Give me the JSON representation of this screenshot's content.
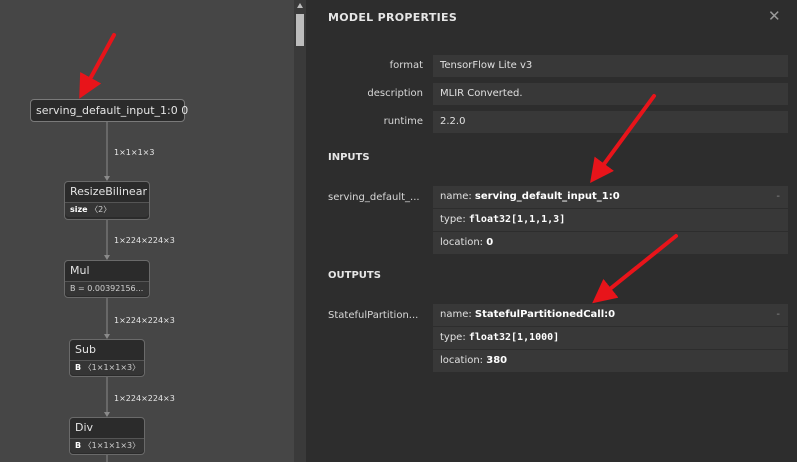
{
  "graph": {
    "input_node": "serving_default_input_1:0 0",
    "edges": [
      "1×1×1×3",
      "1×224×224×3",
      "1×224×224×3",
      "1×224×224×3"
    ],
    "nodes": [
      {
        "name": "ResizeBilinear",
        "attr_key": "size",
        "attr_val": "〈2〉"
      },
      {
        "name": "Mul",
        "attr_key": "",
        "attr_val": "B = 0.00392156..."
      },
      {
        "name": "Sub",
        "attr_key": "B",
        "attr_val": "〈1×1×1×3〉"
      },
      {
        "name": "Div",
        "attr_key": "B",
        "attr_val": "〈1×1×1×3〉"
      }
    ]
  },
  "panel": {
    "title": "MODEL PROPERTIES",
    "close": "✕",
    "properties": [
      {
        "label": "format",
        "value": "TensorFlow Lite v3"
      },
      {
        "label": "description",
        "value": "MLIR Converted."
      },
      {
        "label": "runtime",
        "value": "2.2.0"
      }
    ],
    "inputs": {
      "heading": "INPUTS",
      "label": "serving_default_...",
      "name_key": "name: ",
      "name": "serving_default_input_1:0",
      "type_key": "type: ",
      "type": "float32[1,1,1,3]",
      "location_key": "location: ",
      "location": "0",
      "dash": "-"
    },
    "outputs": {
      "heading": "OUTPUTS",
      "label": "StatefulPartition...",
      "name_key": "name: ",
      "name": "StatefulPartitionedCall:0",
      "type_key": "type: ",
      "type": "float32[1,1000]",
      "location_key": "location: ",
      "location": "380",
      "dash": "-"
    }
  },
  "colors": {
    "arrow": "#e8141a",
    "panel_bg": "#2d2d2d",
    "graph_bg": "#464646"
  }
}
